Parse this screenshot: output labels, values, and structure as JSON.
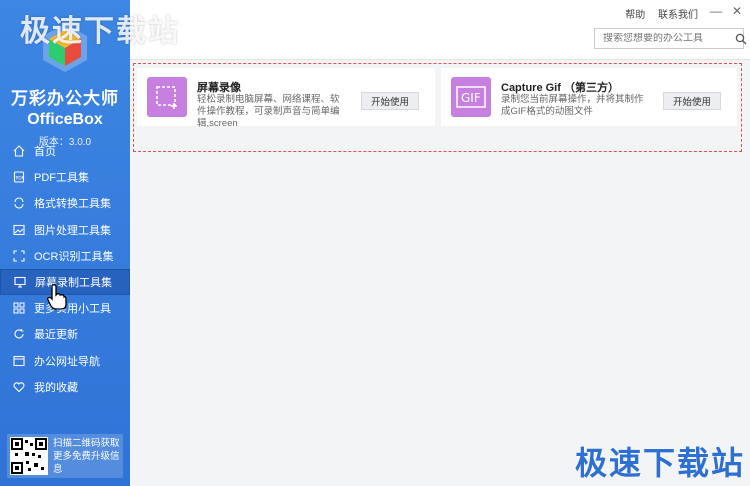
{
  "watermark": {
    "top_left": "极速下载站",
    "bottom_right": "极速下载站"
  },
  "brand": {
    "name": "万彩办公大师",
    "sub": "OfficeBox",
    "version": "版本：3.0.0"
  },
  "nav": [
    {
      "label": "首页",
      "icon": "home-icon"
    },
    {
      "label": "PDF工具集",
      "icon": "pdf-icon"
    },
    {
      "label": "格式转换工具集",
      "icon": "convert-icon"
    },
    {
      "label": "图片处理工具集",
      "icon": "image-icon"
    },
    {
      "label": "OCR识别工具集",
      "icon": "ocr-icon"
    },
    {
      "label": "屏幕录制工具集",
      "icon": "monitor-icon",
      "active": true
    },
    {
      "label": "更多实用小工具",
      "icon": "grid-icon"
    },
    {
      "label": "最近更新",
      "icon": "refresh-icon"
    },
    {
      "label": "办公网址导航",
      "icon": "browser-icon"
    },
    {
      "label": "我的收藏",
      "icon": "heart-icon"
    }
  ],
  "qr": {
    "line1": "扫描二维码获取",
    "line2": "更多免费升级信息"
  },
  "topbar": {
    "help": "帮助",
    "contact": "联系我们",
    "search_placeholder": "搜索您想要的办公工具"
  },
  "cards": [
    {
      "title": "屏幕录像",
      "desc": "轻松录制电脑屏幕、网络课程、软件操作教程，可录制声音与简单编辑,screen",
      "button": "开始使用",
      "thumb_color": "#c77fe0"
    },
    {
      "title": "Capture Gif （第三方）",
      "desc": "录制您当前屏幕操作，并将其制作成GIF格式的动图文件",
      "button": "开始使用",
      "thumb_color": "#c77fe0",
      "thumb_text": "GIF"
    }
  ],
  "colors": {
    "sidebar": "#3178dc",
    "accent_red": "#e05050"
  }
}
